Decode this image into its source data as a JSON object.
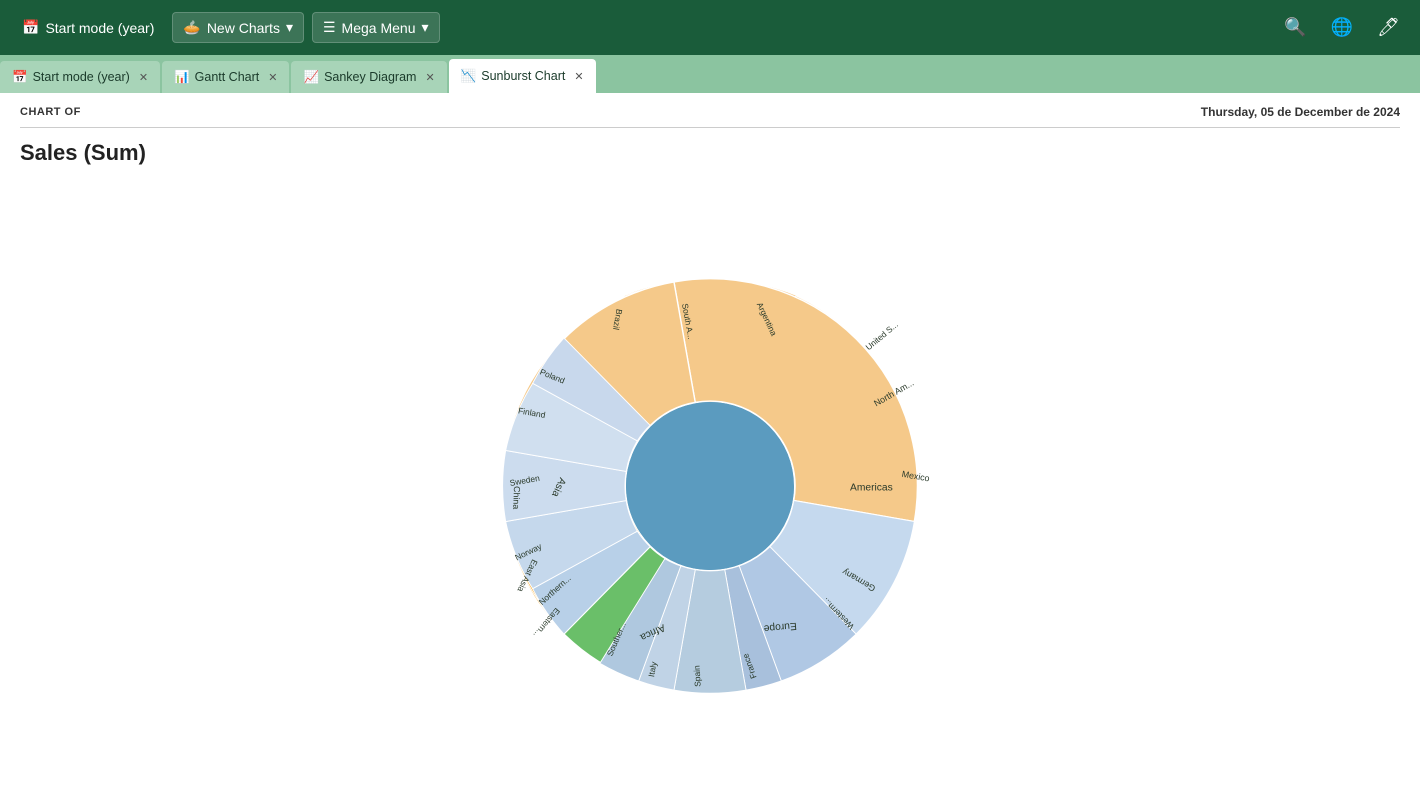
{
  "topnav": {
    "brand_label": "Start mode (year)",
    "new_charts_label": "New Charts",
    "mega_menu_label": "Mega Menu"
  },
  "tabs": [
    {
      "label": "Start mode (year)",
      "icon": "📅",
      "active": false
    },
    {
      "label": "Gantt Chart",
      "icon": "📊",
      "active": false
    },
    {
      "label": "Sankey Diagram",
      "icon": "📈",
      "active": false
    },
    {
      "label": "Sunburst Chart",
      "icon": "📉",
      "active": true
    }
  ],
  "content": {
    "chart_of_label": "CHART OF",
    "date_label": "Thursday, 05 de December de 2024",
    "chart_title": "Sales (Sum)"
  },
  "colors": {
    "americas": "#f5c98a",
    "asia": "#f5a623",
    "europe": "#b8cfe8",
    "africa": "#6abf69",
    "center": "#5b9bbf"
  }
}
